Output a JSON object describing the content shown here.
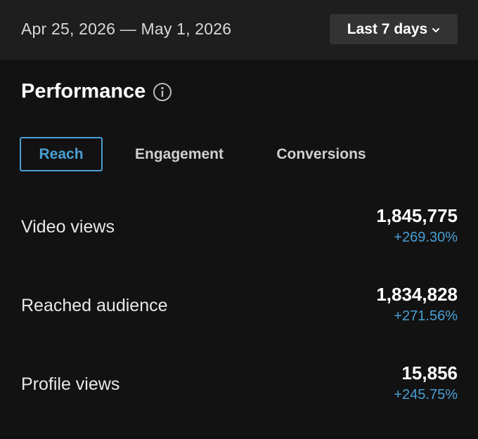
{
  "header": {
    "date_range": "Apr 25, 2026 — May 1, 2026",
    "period_selector": {
      "label": "Last 7 days",
      "icon": "chevron-down-icon"
    }
  },
  "performance": {
    "title": "Performance",
    "info_icon": "info-icon",
    "tabs": [
      {
        "label": "Reach",
        "active": true
      },
      {
        "label": "Engagement",
        "active": false
      },
      {
        "label": "Conversions",
        "active": false
      }
    ],
    "metrics": [
      {
        "label": "Video views",
        "value": "1,845,775",
        "change": "+269.30%"
      },
      {
        "label": "Reached audience",
        "value": "1,834,828",
        "change": "+271.56%"
      },
      {
        "label": "Profile views",
        "value": "15,856",
        "change": "+245.75%"
      }
    ]
  },
  "colors": {
    "accent": "#4a9fd4",
    "background": "#121212",
    "header_background": "#1e1e1e",
    "button_background": "#333333"
  }
}
